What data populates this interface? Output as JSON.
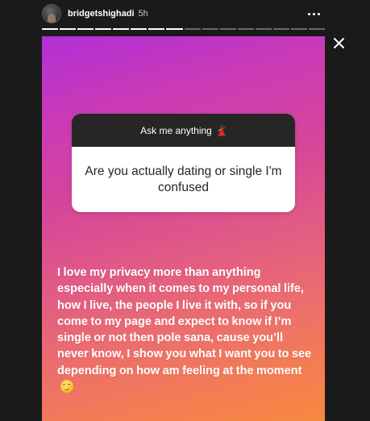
{
  "header": {
    "username": "bridgetshighadi",
    "time": "5h"
  },
  "icons": {
    "avatar": "profile-avatar",
    "more": "more-horizontal-icon",
    "close": "close-icon",
    "flame": "flamenco-dancer-emoji",
    "smirk": "smirk-emoji"
  },
  "progress": {
    "segments": 16,
    "current_segment": 7,
    "current_fill": 1.0
  },
  "question_sticker": {
    "title": "Ask me anything",
    "question": "Are you actually dating or single I'm confused"
  },
  "answer": {
    "text": "I love my privacy more than anything especially when it comes to my personal life, how I live, the people I live it with, so if you  come to my page and expect to know if I’m single or not then pole sana, cause you’ll never know, I show you what I want you to see depending on how am feeling at the moment"
  },
  "colors": {
    "gradient_top": "#b02fd6",
    "gradient_bottom": "#f7893f",
    "sticker_header": "#262626",
    "background": "#1a1a1a"
  }
}
